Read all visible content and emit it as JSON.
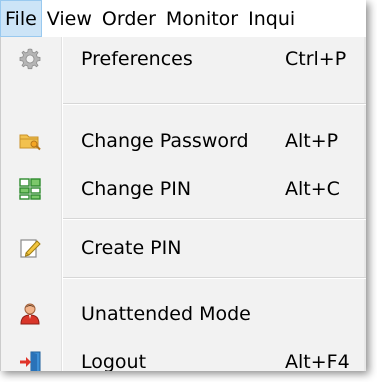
{
  "menubar": {
    "items": [
      {
        "label": "File",
        "active": true
      },
      {
        "label": "View",
        "active": false
      },
      {
        "label": "Order",
        "active": false
      },
      {
        "label": "Monitor",
        "active": false
      },
      {
        "label": "Inqui",
        "active": false
      }
    ]
  },
  "file_menu": {
    "items": [
      {
        "label": "Preferences",
        "shortcut": "Ctrl+P",
        "icon": "gear-icon"
      },
      {
        "label": "Change Password",
        "shortcut": "Alt+P",
        "icon": "folder-key-icon"
      },
      {
        "label": "Change PIN",
        "shortcut": "Alt+C",
        "icon": "grid-pin-icon"
      },
      {
        "label": "Create PIN",
        "shortcut": "",
        "icon": "pencil-note-icon"
      },
      {
        "label": "Unattended Mode",
        "shortcut": "",
        "icon": "user-icon"
      },
      {
        "label": "Logout",
        "shortcut": "Alt+F4",
        "icon": "exit-door-icon"
      }
    ]
  },
  "colors": {
    "menubar_active_bg": "#cce4f7",
    "menubar_active_border": "#99c9ef",
    "menu_bg": "#f2f2f2"
  }
}
